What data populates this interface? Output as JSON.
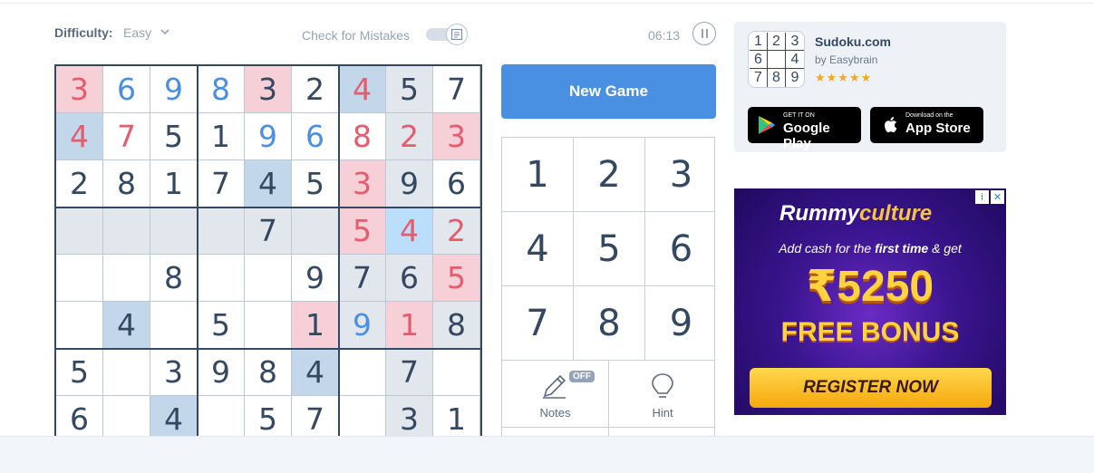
{
  "header": {
    "difficulty_label": "Difficulty:",
    "difficulty_value": "Easy",
    "check_mistakes_label": "Check for Mistakes",
    "timer": "06:13"
  },
  "board": {
    "rows": [
      [
        {
          "v": "3",
          "c": "red",
          "bg": "pink"
        },
        {
          "v": "6",
          "c": "blue",
          "bg": ""
        },
        {
          "v": "9",
          "c": "blue",
          "bg": ""
        },
        {
          "v": "8",
          "c": "blue",
          "bg": ""
        },
        {
          "v": "3",
          "c": "",
          "bg": "pink"
        },
        {
          "v": "2",
          "c": "",
          "bg": ""
        },
        {
          "v": "4",
          "c": "red",
          "bg": "blue"
        },
        {
          "v": "5",
          "c": "",
          "bg": "grey"
        },
        {
          "v": "7",
          "c": "",
          "bg": ""
        }
      ],
      [
        {
          "v": "4",
          "c": "red",
          "bg": "blue"
        },
        {
          "v": "7",
          "c": "red",
          "bg": ""
        },
        {
          "v": "5",
          "c": "",
          "bg": ""
        },
        {
          "v": "1",
          "c": "",
          "bg": ""
        },
        {
          "v": "9",
          "c": "blue",
          "bg": ""
        },
        {
          "v": "6",
          "c": "blue",
          "bg": ""
        },
        {
          "v": "8",
          "c": "red",
          "bg": ""
        },
        {
          "v": "2",
          "c": "red",
          "bg": "grey"
        },
        {
          "v": "3",
          "c": "red",
          "bg": "pink"
        }
      ],
      [
        {
          "v": "2",
          "c": "",
          "bg": ""
        },
        {
          "v": "8",
          "c": "",
          "bg": ""
        },
        {
          "v": "1",
          "c": "",
          "bg": ""
        },
        {
          "v": "7",
          "c": "",
          "bg": ""
        },
        {
          "v": "4",
          "c": "",
          "bg": "blue"
        },
        {
          "v": "5",
          "c": "",
          "bg": ""
        },
        {
          "v": "3",
          "c": "red",
          "bg": "pink"
        },
        {
          "v": "9",
          "c": "",
          "bg": "grey"
        },
        {
          "v": "6",
          "c": "",
          "bg": ""
        }
      ],
      [
        {
          "v": "",
          "c": "",
          "bg": "grey"
        },
        {
          "v": "",
          "c": "",
          "bg": "grey"
        },
        {
          "v": "",
          "c": "",
          "bg": "grey"
        },
        {
          "v": "",
          "c": "",
          "bg": "grey"
        },
        {
          "v": "7",
          "c": "",
          "bg": "grey"
        },
        {
          "v": "",
          "c": "",
          "bg": "grey"
        },
        {
          "v": "5",
          "c": "red",
          "bg": "pink"
        },
        {
          "v": "4",
          "c": "red",
          "bg": "sel"
        },
        {
          "v": "2",
          "c": "red",
          "bg": "grey"
        }
      ],
      [
        {
          "v": "",
          "c": "",
          "bg": ""
        },
        {
          "v": "",
          "c": "",
          "bg": ""
        },
        {
          "v": "8",
          "c": "",
          "bg": ""
        },
        {
          "v": "",
          "c": "",
          "bg": ""
        },
        {
          "v": "",
          "c": "",
          "bg": ""
        },
        {
          "v": "9",
          "c": "",
          "bg": ""
        },
        {
          "v": "7",
          "c": "",
          "bg": "grey"
        },
        {
          "v": "6",
          "c": "",
          "bg": "grey"
        },
        {
          "v": "5",
          "c": "red",
          "bg": "pink"
        }
      ],
      [
        {
          "v": "",
          "c": "",
          "bg": ""
        },
        {
          "v": "4",
          "c": "",
          "bg": "blue"
        },
        {
          "v": "",
          "c": "",
          "bg": ""
        },
        {
          "v": "5",
          "c": "",
          "bg": ""
        },
        {
          "v": "",
          "c": "",
          "bg": ""
        },
        {
          "v": "1",
          "c": "",
          "bg": "pink"
        },
        {
          "v": "9",
          "c": "blue",
          "bg": "grey"
        },
        {
          "v": "1",
          "c": "red",
          "bg": "pink"
        },
        {
          "v": "8",
          "c": "",
          "bg": "grey"
        }
      ],
      [
        {
          "v": "5",
          "c": "",
          "bg": ""
        },
        {
          "v": "",
          "c": "",
          "bg": ""
        },
        {
          "v": "3",
          "c": "",
          "bg": ""
        },
        {
          "v": "9",
          "c": "",
          "bg": ""
        },
        {
          "v": "8",
          "c": "",
          "bg": ""
        },
        {
          "v": "4",
          "c": "",
          "bg": "blue"
        },
        {
          "v": "",
          "c": "",
          "bg": ""
        },
        {
          "v": "7",
          "c": "",
          "bg": "grey"
        },
        {
          "v": "",
          "c": "",
          "bg": ""
        }
      ],
      [
        {
          "v": "6",
          "c": "",
          "bg": ""
        },
        {
          "v": "",
          "c": "",
          "bg": ""
        },
        {
          "v": "4",
          "c": "",
          "bg": "blue"
        },
        {
          "v": "",
          "c": "",
          "bg": ""
        },
        {
          "v": "5",
          "c": "",
          "bg": ""
        },
        {
          "v": "7",
          "c": "",
          "bg": ""
        },
        {
          "v": "",
          "c": "",
          "bg": ""
        },
        {
          "v": "3",
          "c": "",
          "bg": "grey"
        },
        {
          "v": "1",
          "c": "",
          "bg": ""
        }
      ]
    ]
  },
  "controls": {
    "new_game_label": "New Game",
    "numbers": [
      "1",
      "2",
      "3",
      "4",
      "5",
      "6",
      "7",
      "8",
      "9"
    ],
    "notes_label": "Notes",
    "notes_state": "OFF",
    "hint_label": "Hint"
  },
  "promo": {
    "app_name": "Sudoku.com",
    "app_by": "by Easybrain",
    "icon_digits": [
      "1",
      "2",
      "3",
      "6",
      "",
      "4",
      "7",
      "8",
      "9"
    ],
    "rating_stars": "★★★★★",
    "google_small": "GET IT ON",
    "google_big": "Google Play",
    "apple_small": "Download on the",
    "apple_big": "App Store"
  },
  "ad": {
    "brand_a": "Rummy",
    "brand_b": "culture",
    "line_pre": "Add cash for the ",
    "line_bold": "first time",
    "line_post": " & get",
    "amount": "₹5250",
    "bonus": "FREE BONUS",
    "cta": "REGISTER NOW"
  },
  "colors": {
    "text": "#344861",
    "red": "#e55c6c",
    "blue": "#4a90e2",
    "accent": "#4a90e2"
  }
}
